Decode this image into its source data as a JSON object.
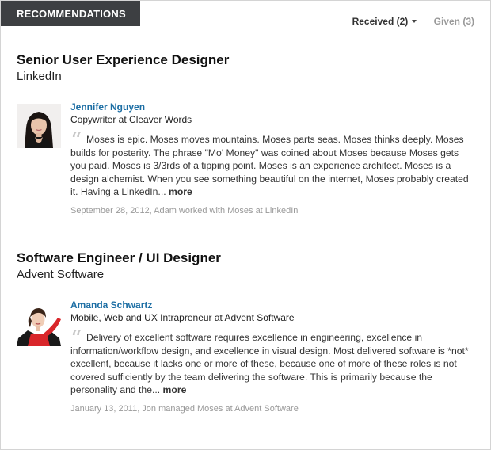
{
  "header": {
    "section_label": "RECOMMENDATIONS",
    "tab_received": "Received (2)",
    "tab_given": "Given (3)"
  },
  "jobs": [
    {
      "title": "Senior User Experience Designer",
      "company": "LinkedIn",
      "recommendation": {
        "name": "Jennifer Nguyen",
        "headline": "Copywriter at Cleaver Words",
        "quote_mark": "“",
        "text": "Moses is epic. Moses moves mountains. Moses parts seas. Moses thinks deeply. Moses builds for posterity. The phrase \"Mo' Money\" was coined about Moses because Moses gets you paid. Moses is 3/3rds of a tipping point. Moses is an experience architect. Moses is a design alchemist. When you see something beautiful on the internet, Moses probably created it. Having a LinkedIn...",
        "more": "more",
        "meta": "September 28, 2012, Adam worked with Moses at LinkedIn"
      }
    },
    {
      "title": "Software Engineer / UI Designer",
      "company": "Advent Software",
      "recommendation": {
        "name": "Amanda Schwartz",
        "headline": "Mobile, Web and UX Intrapreneur at Advent Software",
        "quote_mark": "“",
        "text": "Delivery of excellent software requires excellence in engineering, excellence in information/workflow design, and excellence in visual design. Most delivered software is *not* excellent, because it lacks one or more of these, because one of more of these roles is not covered sufficiently by the team delivering the software. This is primarily because the personality and the...",
        "more": "more",
        "meta": "January 13, 2011, Jon managed Moses at Advent Software"
      }
    }
  ],
  "colors": {
    "link": "#1c6ea4",
    "tab_background": "#3d3f42",
    "meta_text": "#999999"
  }
}
